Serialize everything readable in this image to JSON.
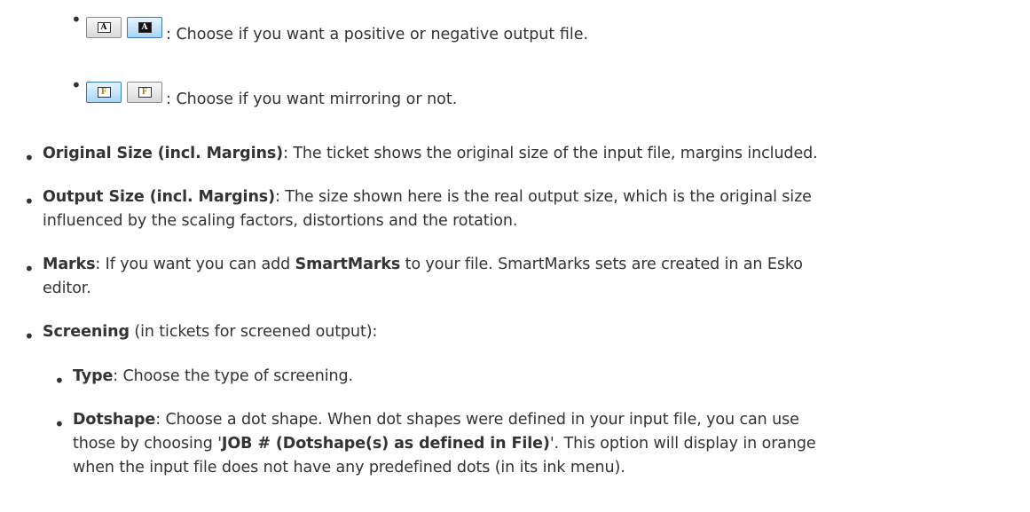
{
  "icon_rows": [
    {
      "buttons": [
        {
          "name": "positive-output-button",
          "glyph": "A",
          "active": false
        },
        {
          "name": "negative-output-button",
          "glyph": "A",
          "active": true
        }
      ],
      "text": ": Choose if you want a positive or negative output file."
    },
    {
      "buttons": [
        {
          "name": "mirror-on-button",
          "glyph": "F",
          "active": true
        },
        {
          "name": "mirror-off-button",
          "glyph": "F",
          "active": false
        }
      ],
      "text": ": Choose if you want mirroring or not."
    }
  ],
  "items": [
    {
      "label": "Original Size (incl. Margins)",
      "text": ": The ticket shows the original size of the input file, margins included."
    },
    {
      "label": "Output Size (incl. Margins)",
      "text": ": The size shown here is the real output size, which is the original size",
      "text2": "influenced by the scaling factors, distortions and the rotation."
    },
    {
      "label": "Marks",
      "text_a": ": If you want you can add ",
      "label_b": "SmartMarks",
      "text_b": " to your file. SmartMarks sets are created in an Esko",
      "text2": "editor."
    },
    {
      "label": "Screening",
      "text": " (in tickets for screened output):"
    }
  ],
  "subitems": [
    {
      "label": "Type",
      "text": ": Choose the type of screening."
    },
    {
      "label": "Dotshape",
      "text": ": Choose a dot shape. When dot shapes were defined in your input file, you can use",
      "text2a": "those by choosing '",
      "label2": "JOB # (Dotshape(s) as defined in File)",
      "text2b": "'. This option will display in orange",
      "text3": "when the input file does not have any predefined dots (in its ink menu)."
    }
  ],
  "bullet_char": "•"
}
